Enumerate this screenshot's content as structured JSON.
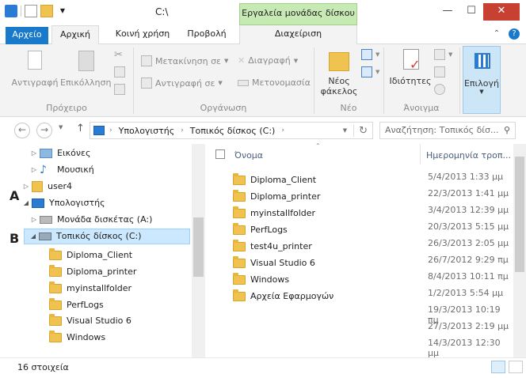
{
  "window": {
    "title": "C:\\",
    "context_tab": "Εργαλεία μονάδας δίσκου"
  },
  "tabs": {
    "file": "Αρχείο",
    "home": "Αρχική",
    "share": "Κοινή χρήση",
    "view": "Προβολή",
    "manage": "Διαχείριση"
  },
  "ribbon": {
    "clipboard": {
      "copy": "Αντιγραφή",
      "paste": "Επικόλληση",
      "label": "Πρόχειρο"
    },
    "organize": {
      "move_to": "Μετακίνηση σε",
      "copy_to": "Αντιγραφή σε",
      "delete": "Διαγραφή",
      "rename": "Μετονομασία",
      "label": "Οργάνωση"
    },
    "new": {
      "new_folder_l1": "Νέος",
      "new_folder_l2": "φάκελος",
      "label": "Νέο"
    },
    "open": {
      "properties": "Ιδιότητες",
      "label": "Άνοιγμα"
    },
    "select": {
      "select": "Επιλογή"
    }
  },
  "address": {
    "path": [
      "Υπολογιστής",
      "Τοπικός δίσκος (C:)"
    ],
    "search_placeholder": "Αναζήτηση: Τοπικός δίσ..."
  },
  "navpane": {
    "pictures": "Εικόνες",
    "music": "Μουσική",
    "user": "user4",
    "computer": "Υπολογιστής",
    "floppy": "Μονάδα δισκέτας (A:)",
    "local_disk": "Τοπικός δίσκος (C:)",
    "folders": [
      "Diploma_Client",
      "Diploma_printer",
      "myinstallfolder",
      "PerfLogs",
      "Visual Studio 6",
      "Windows"
    ]
  },
  "markers": {
    "a": "A",
    "b": "B"
  },
  "list": {
    "col_name": "Όνομα",
    "col_date": "Ημερομηνία τροπ...",
    "items": [
      {
        "name": "Diploma_Client",
        "date": "5/4/2013 1:33 μμ"
      },
      {
        "name": "Diploma_printer",
        "date": "22/3/2013 1:41 μμ"
      },
      {
        "name": "myinstallfolder",
        "date": "3/4/2013 12:39 μμ"
      },
      {
        "name": "PerfLogs",
        "date": "20/3/2013 5:15 μμ"
      },
      {
        "name": "test4u_printer",
        "date": "26/3/2013 2:05 μμ"
      },
      {
        "name": "Visual Studio 6",
        "date": "26/7/2012 9:29 πμ"
      },
      {
        "name": "Windows",
        "date": "8/4/2013 10:11 πμ"
      },
      {
        "name": "Αρχεία Εφαρμογών",
        "date": "1/2/2013 5:54 μμ"
      },
      {
        "name": "",
        "date": "19/3/2013 10:19 πμ"
      },
      {
        "name": "",
        "date": "27/3/2013 2:19 μμ"
      },
      {
        "name": "",
        "date": "14/3/2013 12:30 μμ"
      }
    ]
  },
  "status": {
    "count": "16 στοιχεία"
  }
}
